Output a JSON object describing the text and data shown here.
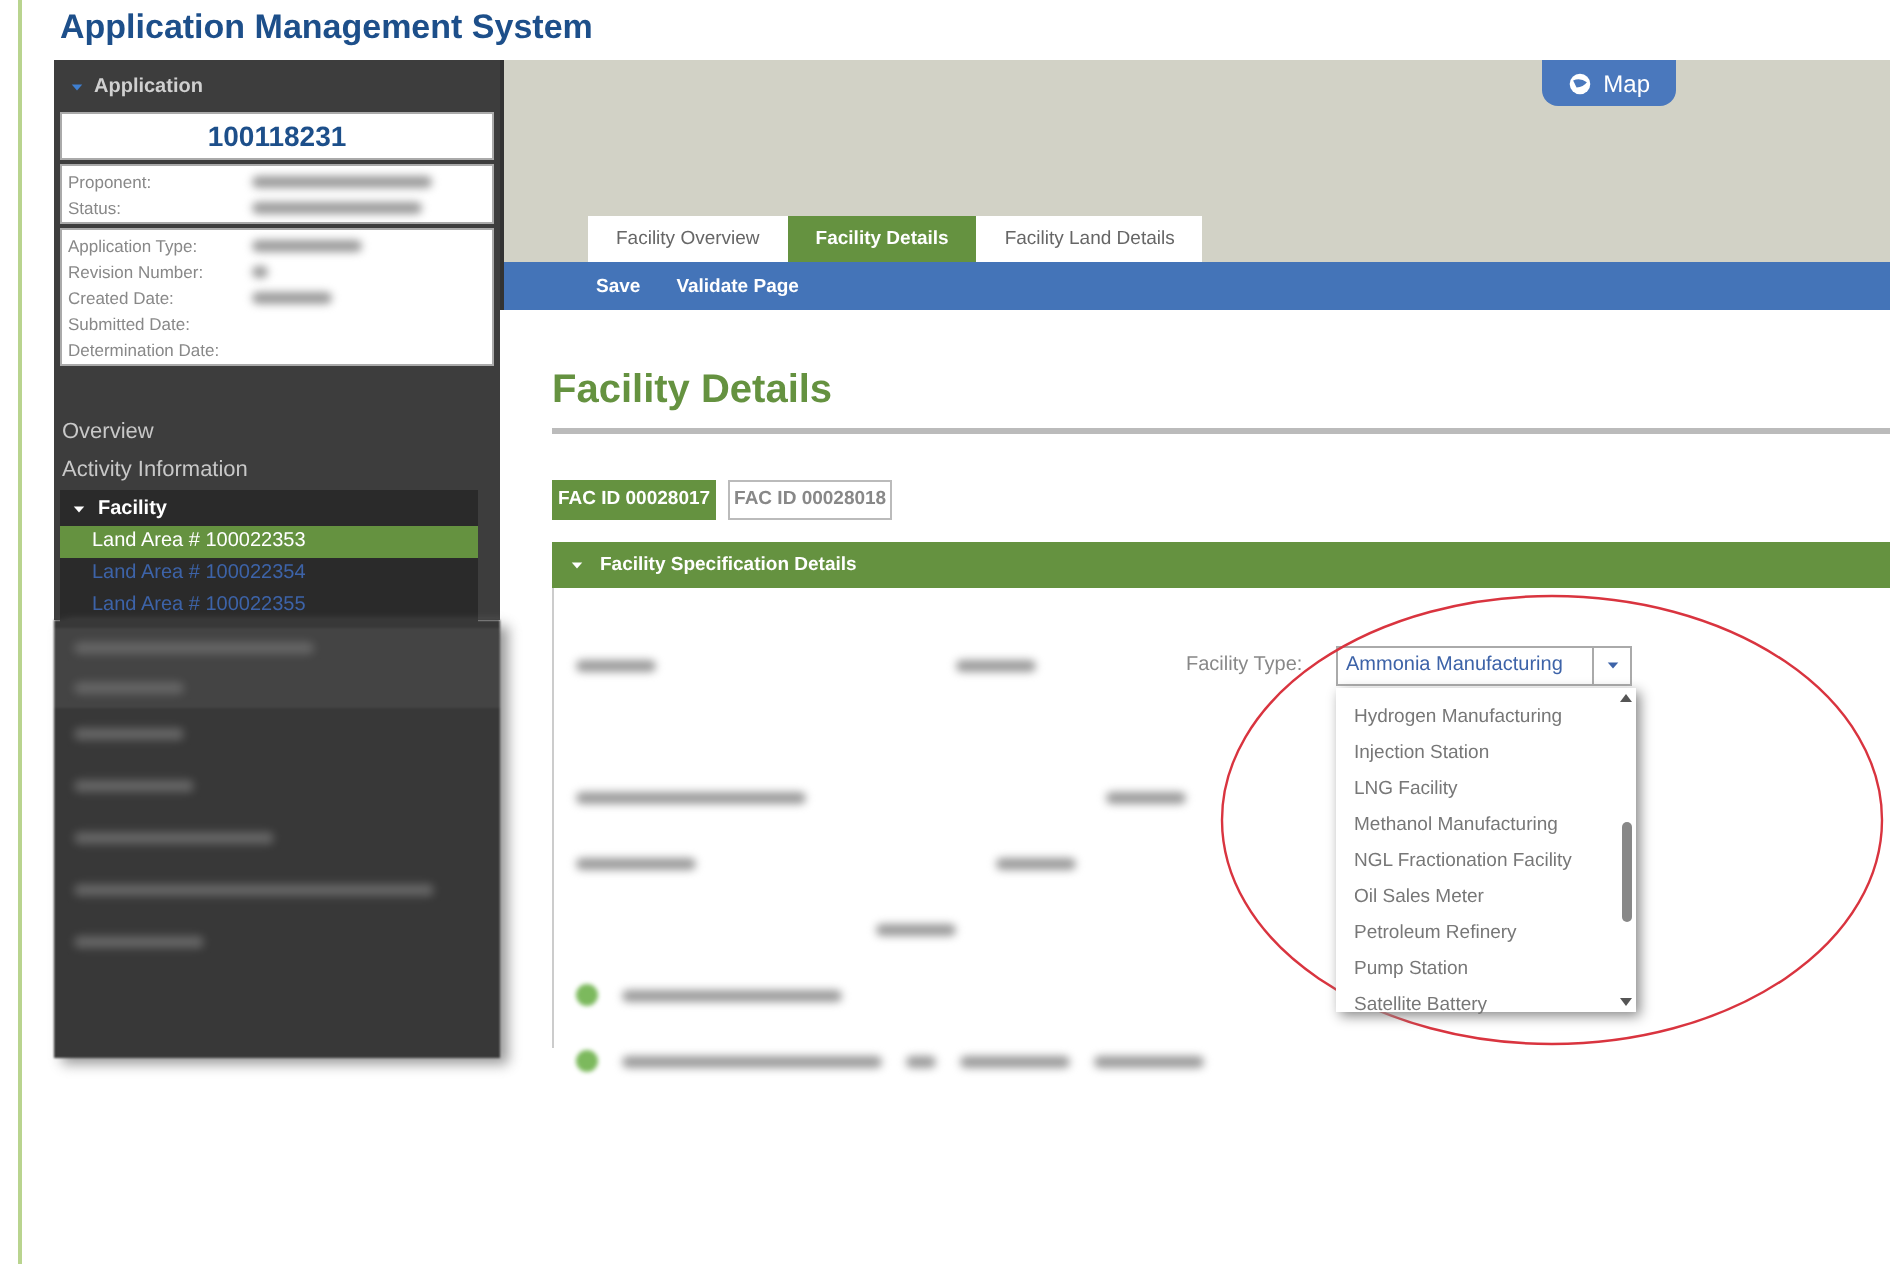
{
  "app_title": "Application Management System",
  "sidebar": {
    "section": {
      "label": "Application",
      "expanded": true
    },
    "application_number": "100118231",
    "summary_fields": [
      "Proponent:",
      "Status:"
    ],
    "detail_fields": [
      "Application Type:",
      "Revision Number:",
      "Created Date:",
      "Submitted Date:",
      "Determination Date:"
    ],
    "nav": [
      "Overview",
      "Activity Information"
    ],
    "tree": {
      "label": "Facility",
      "expanded": true,
      "children": [
        {
          "label": "Land Area # 100022353",
          "selected": true
        },
        {
          "label": "Land Area # 100022354",
          "selected": false
        },
        {
          "label": "Land Area # 100022355",
          "selected": false
        }
      ]
    }
  },
  "map_button": "Map",
  "tabs": [
    {
      "label": "Facility Overview",
      "selected": false
    },
    {
      "label": "Facility Details",
      "selected": true
    },
    {
      "label": "Facility Land Details",
      "selected": false
    }
  ],
  "actions": [
    "Save",
    "Validate Page"
  ],
  "page_title": "Facility Details",
  "facility_ids": [
    {
      "label": "FAC ID 00028017",
      "selected": true
    },
    {
      "label": "FAC ID 00028018",
      "selected": false
    }
  ],
  "section": {
    "title": "Facility Specification Details",
    "expanded": true
  },
  "facility_type": {
    "label": "Facility Type:",
    "value": "Ammonia Manufacturing",
    "expanded": true,
    "options": [
      "Hydrogen Manufacturing",
      "Injection Station",
      "LNG Facility",
      "Methanol Manufacturing",
      "NGL Fractionation Facility",
      "Oil Sales Meter",
      "Petroleum Refinery",
      "Pump Station",
      "Satellite Battery"
    ]
  }
}
